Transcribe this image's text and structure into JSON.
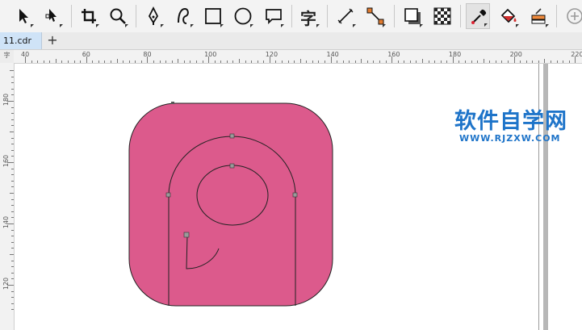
{
  "toolbar": {
    "tools": [
      {
        "name": "pick-tool",
        "icon": "arrow-pointer-icon"
      },
      {
        "name": "shape-tool",
        "icon": "node-edit-icon"
      },
      {
        "name": "crop-tool",
        "icon": "crop-icon"
      },
      {
        "name": "zoom-tool",
        "icon": "magnifier-icon"
      },
      {
        "name": "freehand-tool",
        "icon": "pen-nib-icon"
      },
      {
        "name": "artistic-media-tool",
        "icon": "curve-icon"
      },
      {
        "name": "rectangle-tool",
        "icon": "rectangle-icon"
      },
      {
        "name": "ellipse-tool",
        "icon": "ellipse-icon"
      },
      {
        "name": "callout-tool",
        "icon": "speech-bubble-icon"
      },
      {
        "name": "text-tool",
        "icon": "text-glyph-icon"
      },
      {
        "name": "dimension-tool",
        "icon": "diagonal-line-icon"
      },
      {
        "name": "connector-tool",
        "icon": "connector-icon"
      },
      {
        "name": "drop-shadow-tool",
        "icon": "drop-shadow-icon"
      },
      {
        "name": "transparency-tool",
        "icon": "checkerboard-icon"
      },
      {
        "name": "eyedropper-tool",
        "icon": "eyedropper-icon"
      },
      {
        "name": "interactive-fill-tool",
        "icon": "paint-bucket-icon"
      },
      {
        "name": "smart-fill-tool",
        "icon": "smart-fill-icon"
      },
      {
        "name": "add-tool",
        "icon": "plus-circle-icon"
      }
    ],
    "text_tool_glyph": "字"
  },
  "tabs": {
    "document": "11.cdr",
    "new_tab": "+"
  },
  "ruler": {
    "corner": "字",
    "horizontal_ticks": [
      "40",
      "60",
      "80",
      "100",
      "120",
      "140",
      "160",
      "180",
      "200",
      "220"
    ],
    "vertical_ticks": [
      "180",
      "160",
      "140",
      "120"
    ]
  },
  "colors": {
    "shape_fill": "#dc5a8c",
    "outline": "#222222",
    "watermark": "#1e74c9",
    "toolbar_bg": "#f3f3f3",
    "active_tab": "#cfe3f7"
  },
  "watermark": {
    "title": "软件自学网",
    "url": "WWW.RJZXW.COM"
  }
}
